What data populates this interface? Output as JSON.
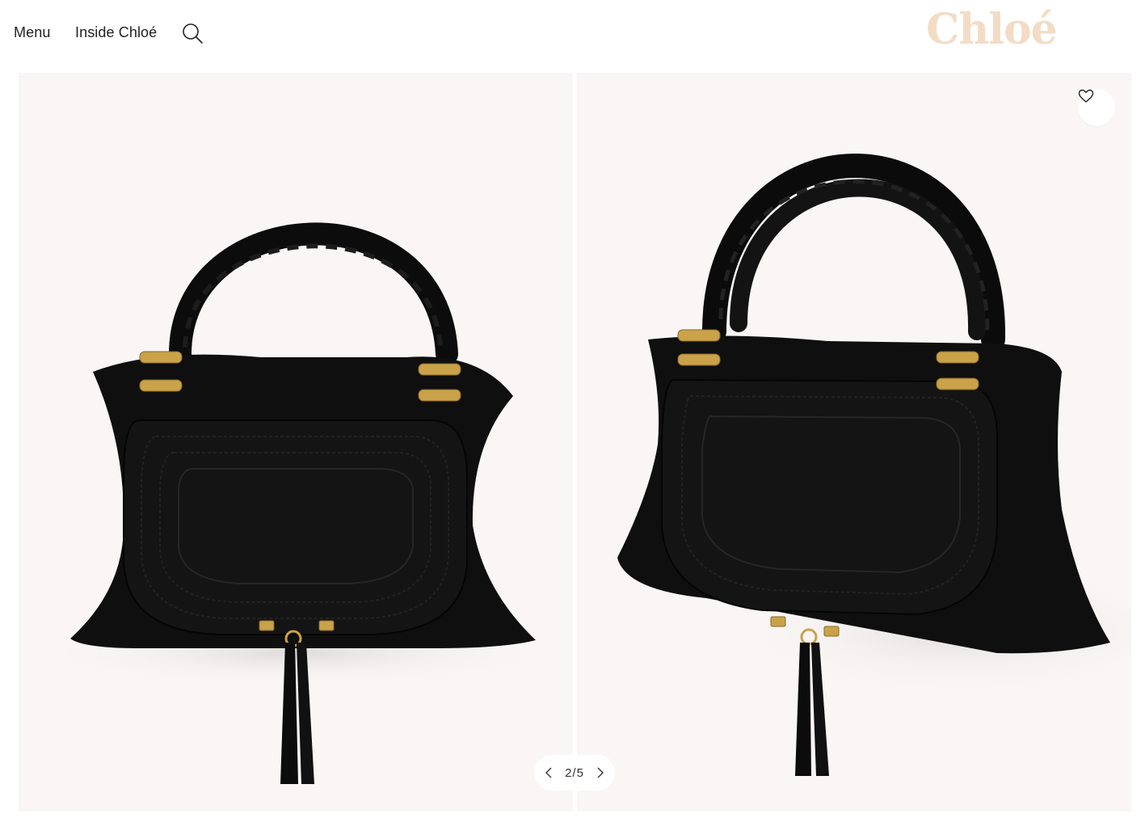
{
  "header": {
    "menu_label": "Menu",
    "inside_label": "Inside Chloé",
    "search_icon": "search-icon",
    "logo_text": "Chloé",
    "logo_color": "#f3dcc6"
  },
  "gallery": {
    "background": "#f9f6f5",
    "images": [
      {
        "alt": "Marcie large bag front view",
        "icon": "handbag-image"
      },
      {
        "alt": "Marcie large bag three-quarter view",
        "icon": "handbag-image"
      }
    ],
    "favorite_icon": "heart-icon",
    "pager": {
      "current": "2",
      "separator": "/",
      "total": "5",
      "prev_icon": "chevron-left-icon",
      "next_icon": "chevron-right-icon"
    }
  }
}
